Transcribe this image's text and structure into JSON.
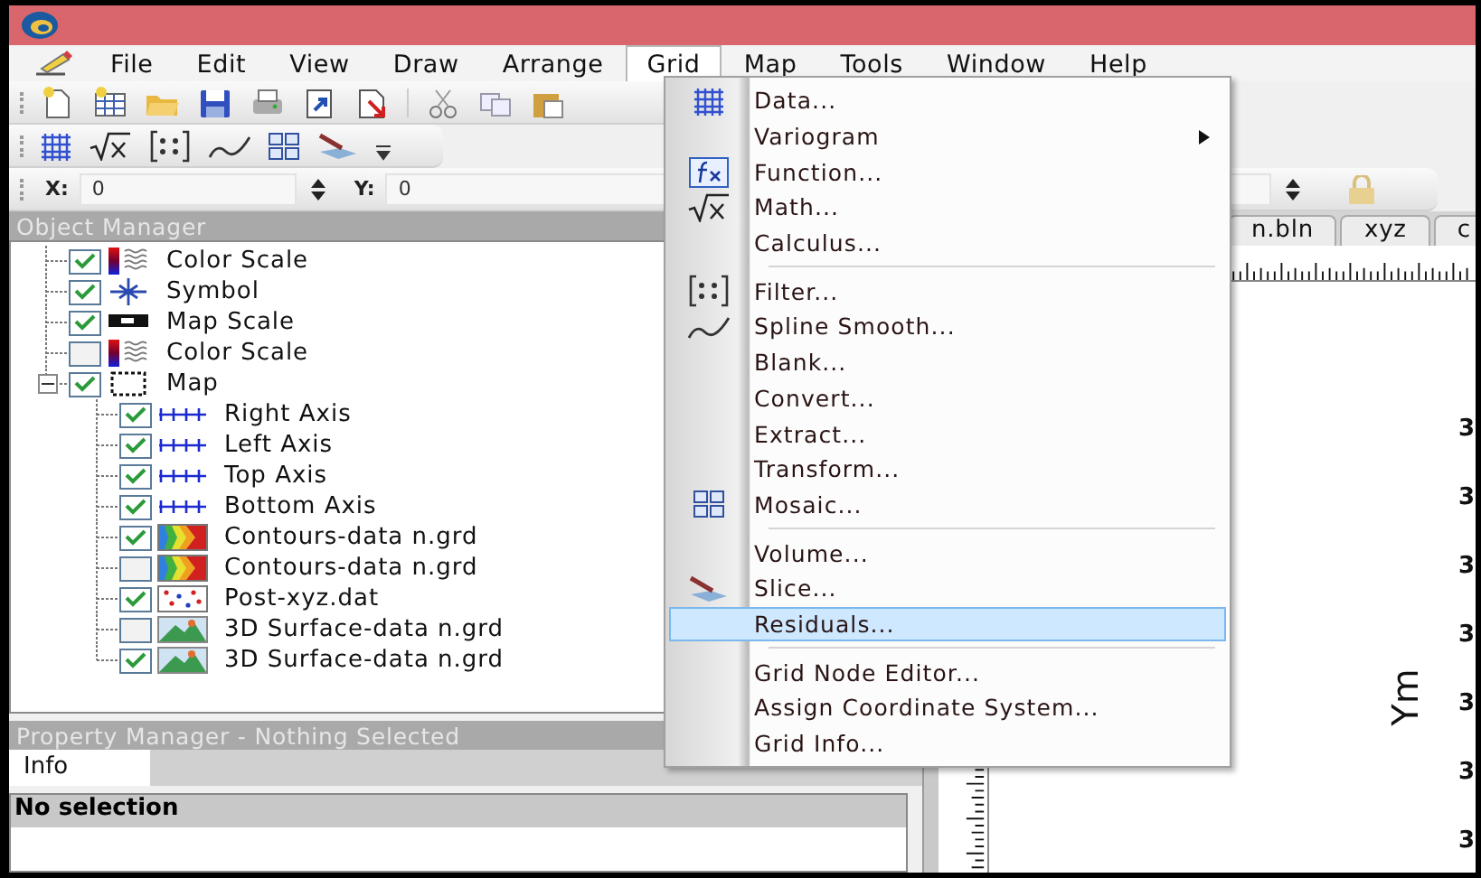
{
  "menu_bar": [
    {
      "label": "File",
      "selected": false
    },
    {
      "label": "Edit",
      "selected": false
    },
    {
      "label": "View",
      "selected": false
    },
    {
      "label": "Draw",
      "selected": false
    },
    {
      "label": "Arrange",
      "selected": false
    },
    {
      "label": "Grid",
      "selected": true
    },
    {
      "label": "Map",
      "selected": false
    },
    {
      "label": "Tools",
      "selected": false
    },
    {
      "label": "Window",
      "selected": false
    },
    {
      "label": "Help",
      "selected": false
    }
  ],
  "coordinate_bar": {
    "x_label": "X:",
    "x_value": "0",
    "y_label": "Y:",
    "y_value": "0"
  },
  "object_manager": {
    "title": "Object Manager",
    "items": [
      {
        "label": "Color Scale",
        "checked": true,
        "kind": "color-scale"
      },
      {
        "label": "Symbol",
        "checked": true,
        "kind": "symbol"
      },
      {
        "label": "Map Scale",
        "checked": true,
        "kind": "map-scale"
      },
      {
        "label": "Color Scale",
        "checked": false,
        "kind": "color-scale"
      },
      {
        "label": "Map",
        "checked": true,
        "kind": "map",
        "expanded": true,
        "children": [
          {
            "label": "Right Axis",
            "checked": true,
            "kind": "axis"
          },
          {
            "label": "Left Axis",
            "checked": true,
            "kind": "axis"
          },
          {
            "label": "Top Axis",
            "checked": true,
            "kind": "axis"
          },
          {
            "label": "Bottom Axis",
            "checked": true,
            "kind": "axis"
          },
          {
            "label": "Contours-data n.grd",
            "checked": true,
            "kind": "contours"
          },
          {
            "label": "Contours-data n.grd",
            "checked": false,
            "kind": "contours"
          },
          {
            "label": "Post-xyz.dat",
            "checked": true,
            "kind": "post"
          },
          {
            "label": "3D Surface-data n.grd",
            "checked": false,
            "kind": "surface"
          },
          {
            "label": "3D Surface-data n.grd",
            "checked": true,
            "kind": "surface"
          }
        ]
      }
    ]
  },
  "property_manager": {
    "title": "Property Manager - Nothing Selected",
    "tabs": [
      {
        "label": "Info",
        "selected": true
      }
    ],
    "header": "No selection"
  },
  "document": {
    "tabs": [
      {
        "label": "n.bln",
        "selected": false
      },
      {
        "label": "xyz",
        "selected": false
      },
      {
        "label": "c",
        "selected": false
      }
    ],
    "y_axis_title": "Ym",
    "y_tick_labels": [
      "3",
      "3",
      "3",
      "3",
      "3",
      "3",
      "3"
    ]
  },
  "grid_menu": {
    "items": [
      {
        "kind": "grid",
        "label": "Data...",
        "highlighted": false
      },
      {
        "kind": "submenu",
        "label": "Variogram",
        "highlighted": false
      },
      {
        "kind": "function",
        "label": "Function...",
        "highlighted": false
      },
      {
        "kind": "math",
        "label": "Math...",
        "highlighted": false
      },
      {
        "kind": "plain",
        "label": "Calculus...",
        "highlighted": false
      },
      {
        "kind": "separator"
      },
      {
        "kind": "filter",
        "label": "Filter...",
        "highlighted": false
      },
      {
        "kind": "spline",
        "label": "Spline Smooth...",
        "highlighted": false
      },
      {
        "kind": "plain",
        "label": "Blank...",
        "highlighted": false
      },
      {
        "kind": "plain",
        "label": "Convert...",
        "highlighted": false
      },
      {
        "kind": "plain",
        "label": "Extract...",
        "highlighted": false
      },
      {
        "kind": "plain",
        "label": "Transform...",
        "highlighted": false
      },
      {
        "kind": "mosaic",
        "label": "Mosaic...",
        "highlighted": false
      },
      {
        "kind": "separator"
      },
      {
        "kind": "plain",
        "label": "Volume...",
        "highlighted": false
      },
      {
        "kind": "slice",
        "label": "Slice...",
        "highlighted": false
      },
      {
        "kind": "plain",
        "label": "Residuals...",
        "highlighted": true
      },
      {
        "kind": "separator"
      },
      {
        "kind": "plain",
        "label": "Grid Node Editor...",
        "highlighted": false
      },
      {
        "kind": "plain",
        "label": "Assign Coordinate System...",
        "highlighted": false
      },
      {
        "kind": "plain",
        "label": "Grid Info...",
        "highlighted": false
      }
    ]
  }
}
